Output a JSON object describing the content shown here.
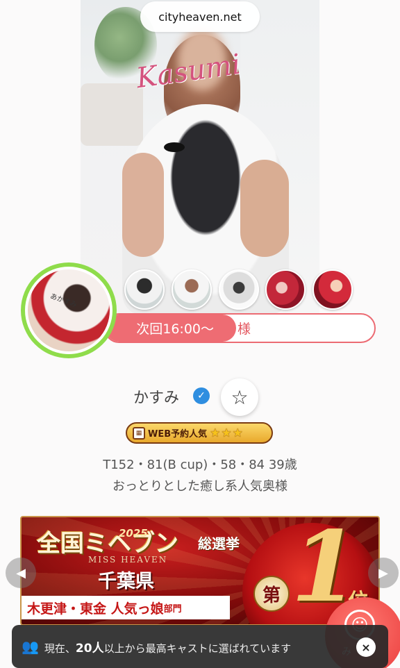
{
  "browser": {
    "url": "cityheaven.net"
  },
  "profile": {
    "photo_caption": "Kasumi",
    "avatar_caption": "あかすみ",
    "thumbnails": [
      "gallery-photo-1",
      "gallery-photo-2",
      "gallery-photo-3",
      "gallery-photo-4",
      "gallery-photo-5"
    ],
    "schedule_label": "次回16:00〜",
    "schedule_trailing": "様",
    "name": "かすみ",
    "verified_icon": "check",
    "favorite_icon": "☆",
    "badge_text": "WEB予約人気",
    "badge_stars": "★★★",
    "specs": "T152・81(B cup)・58・84  39歳",
    "catchphrase": "おっとりとした癒し系人気奥様"
  },
  "banner": {
    "title": "全国ミヘブン",
    "year": "2025",
    "subtitle": "総選挙",
    "miss": "MISS HEAVEN",
    "prefecture": "千葉県",
    "region": "木更津・東金  人気っ娘",
    "region_suffix": "部門",
    "rank_prefix": "第",
    "rank": "1",
    "rank_suffix": "位"
  },
  "fab": {
    "label": "み",
    "icon": "☺"
  },
  "toast": {
    "prefix": "現在、",
    "count": "20人",
    "suffix": "以上から最高キャストに選ばれています",
    "close_icon": "×"
  },
  "colors": {
    "accent": "#ee6c73",
    "ring": "#8fdc4b",
    "verified": "#2f8ee0"
  }
}
